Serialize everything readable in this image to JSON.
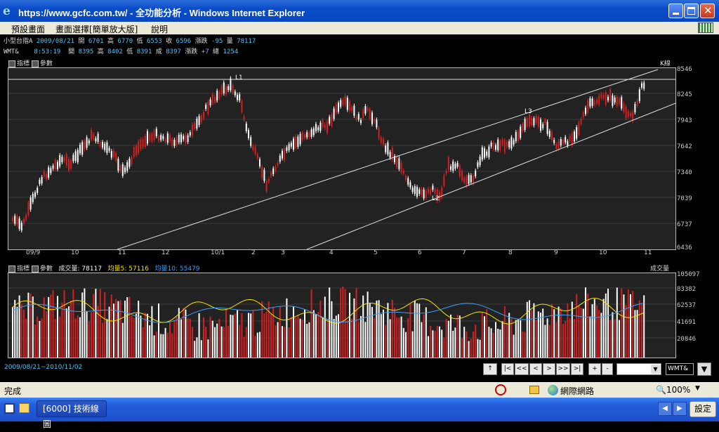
{
  "window": {
    "title": "https://www.gcfc.com.tw/ - 全功能分析 - Windows Internet Explorer"
  },
  "menu": [
    "預設畫面",
    "畫面選擇[簡單放大版]",
    "說明"
  ],
  "quote1": {
    "name": "小型台指A",
    "date": "2009/08/21",
    "open_label": "開",
    "open": "6701",
    "high_label": "高",
    "high": "6770",
    "low_label": "低",
    "low": "6553",
    "close_label": "收",
    "close": "6596",
    "change_label": "漲跌",
    "change": "-95",
    "vol_label": "量",
    "vol": "78117"
  },
  "quote2": {
    "name": "WMT&",
    "time": "8:53:19",
    "open_label": "開",
    "open": "8395",
    "high_label": "高",
    "high": "8402",
    "low_label": "低",
    "low": "8391",
    "close_label": "成",
    "close": "8397",
    "change_label": "漲跌",
    "change": "+7",
    "total_label": "總",
    "total": "1254"
  },
  "price_panel": {
    "indicator_label": "指標",
    "params_label": "參數",
    "title": "K線",
    "y_ticks": [
      "8546",
      "8245",
      "7943",
      "7642",
      "7340",
      "7039",
      "6737",
      "6436"
    ],
    "x_ticks": [
      "09/9",
      "10",
      "11",
      "12",
      "10/1",
      "2",
      "3",
      "4",
      "5",
      "6",
      "7",
      "8",
      "9",
      "10",
      "11"
    ],
    "annotations": [
      "L1",
      "L3",
      "L2"
    ]
  },
  "volume_panel": {
    "indicator_label": "指標",
    "params_label": "參數",
    "vol_label": "成交量:",
    "vol_value": "78117",
    "ma5_label": "均量5:",
    "ma5_value": "57116",
    "ma10_label": "均量10:",
    "ma10_value": "55479",
    "title": "成交量",
    "y_ticks": [
      "105097",
      "83382",
      "62537",
      "41691",
      "20846"
    ]
  },
  "date_range": "2009/08/21~2010/11/02",
  "nav": {
    "buttons": [
      "↑",
      "|<",
      "<<",
      "<",
      ">",
      ">>",
      ">|",
      "+",
      "-"
    ],
    "symbol": "WMT&",
    "dropdown": ""
  },
  "status": {
    "text": "完成",
    "zone": "網際網路",
    "zoom": "100%"
  },
  "taskbar": {
    "task": "[6000] 技術線圖",
    "settings": "設定"
  },
  "colors": {
    "up": "#d42020",
    "down": "#ffffff",
    "ma5": "#f5e600",
    "ma10": "#3aa0ff",
    "trendline": "#e0e0e0"
  }
}
